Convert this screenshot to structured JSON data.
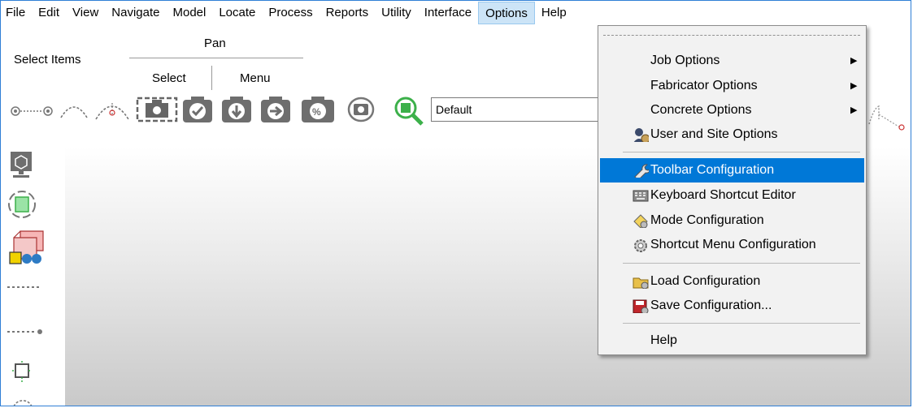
{
  "menubar": {
    "items": [
      "File",
      "Edit",
      "View",
      "Navigate",
      "Model",
      "Locate",
      "Process",
      "Reports",
      "Utility",
      "Interface",
      "Options",
      "Help"
    ],
    "open_item": "Options"
  },
  "toolbar": {
    "pan_label": "Pan",
    "select_items_label": "Select Items",
    "select_label": "Select",
    "menu_label": "Menu",
    "view_combo_value": "Default"
  },
  "options_menu": {
    "job_options": "Job Options",
    "fabricator_options": "Fabricator Options",
    "concrete_options": "Concrete Options",
    "user_site_options": "User and Site Options",
    "toolbar_configuration": "Toolbar Configuration",
    "keyboard_shortcut_editor": "Keyboard Shortcut Editor",
    "mode_configuration": "Mode Configuration",
    "shortcut_menu_configuration": "Shortcut Menu Configuration",
    "load_configuration": "Load Configuration",
    "save_configuration": "Save Configuration...",
    "help": "Help"
  },
  "colors": {
    "highlight": "#0078d7",
    "menu_open": "#cce4f7",
    "icon_dark": "#6e6e6e",
    "zoom_green": "#3cb04a"
  }
}
